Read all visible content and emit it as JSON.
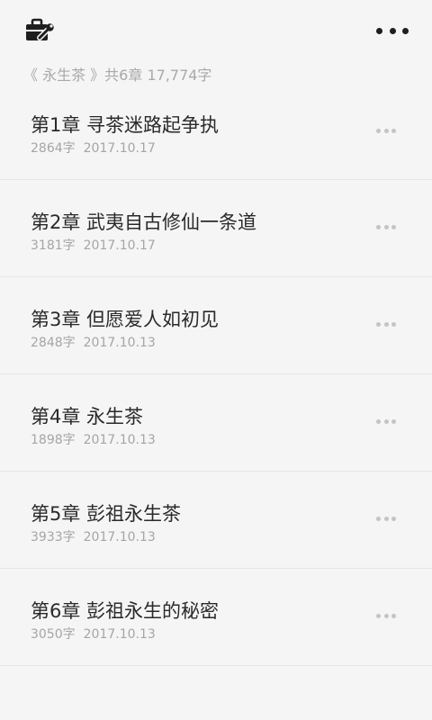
{
  "header": {
    "tool_icon": "briefcase-wrench-icon",
    "more_icon": "more-horizontal-icon"
  },
  "book": {
    "info": "《 永生茶 》共6章 17,774字"
  },
  "chapters": [
    {
      "title": "第1章 寻茶迷路起争执",
      "words": "2864字",
      "date": "2017.10.17"
    },
    {
      "title": "第2章 武夷自古修仙一条道",
      "words": "3181字",
      "date": "2017.10.17"
    },
    {
      "title": "第3章 但愿爱人如初见",
      "words": "2848字",
      "date": "2017.10.13"
    },
    {
      "title": "第4章 永生茶",
      "words": "1898字",
      "date": "2017.10.13"
    },
    {
      "title": "第5章 彭祖永生茶",
      "words": "3933字",
      "date": "2017.10.13"
    },
    {
      "title": "第6章 彭祖永生的秘密",
      "words": "3050字",
      "date": "2017.10.13"
    }
  ]
}
